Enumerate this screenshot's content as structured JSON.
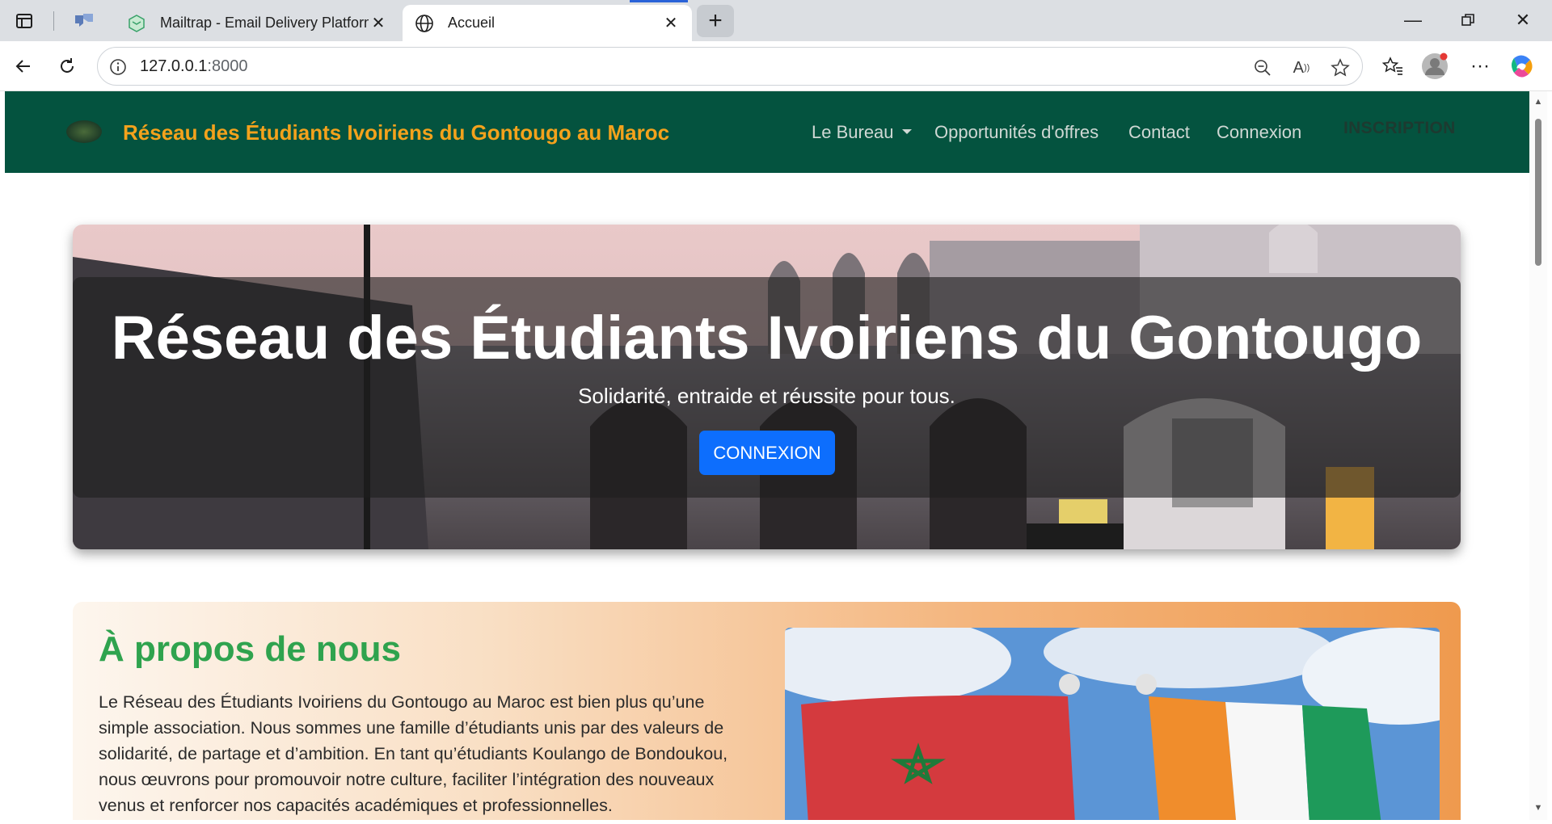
{
  "browser": {
    "tabs": [
      {
        "label": "Mailtrap - Email Delivery Platform",
        "favicon": "mailtrap-icon"
      },
      {
        "label": "Accueil",
        "favicon": "globe-icon"
      }
    ],
    "url_host": "127.0.0.1",
    "url_port": ":8000"
  },
  "site": {
    "brand": "Réseau des Étudiants Ivoiriens du Gontougo au Maroc",
    "nav": {
      "bureau": "Le Bureau",
      "offres": "Opportunités d'offres",
      "contact": "Contact",
      "connexion": "Connexion",
      "inscription": "INSCRIPTION"
    },
    "hero": {
      "title": "Réseau des Étudiants Ivoiriens du Gontougo",
      "subtitle": "Solidarité, entraide et réussite pour tous.",
      "button": "CONNEXION"
    },
    "about": {
      "title": "À propos de nous",
      "text": "Le Réseau des Étudiants Ivoiriens du Gontougo au Maroc est bien plus qu’une simple association. Nous sommes une famille d’étudiants unis par des valeurs de solidarité, de partage et d’ambition. En tant qu’étudiants Koulango de Bondoukou, nous œuvrons pour promouvoir notre culture, faciliter l’intégration des nouveaux venus et renforcer nos capacités académiques et professionnelles."
    }
  },
  "colors": {
    "nav_bg": "#04533f",
    "brand": "#f4a21c",
    "button": "#0d6efd",
    "about_title": "#2fa34e"
  }
}
